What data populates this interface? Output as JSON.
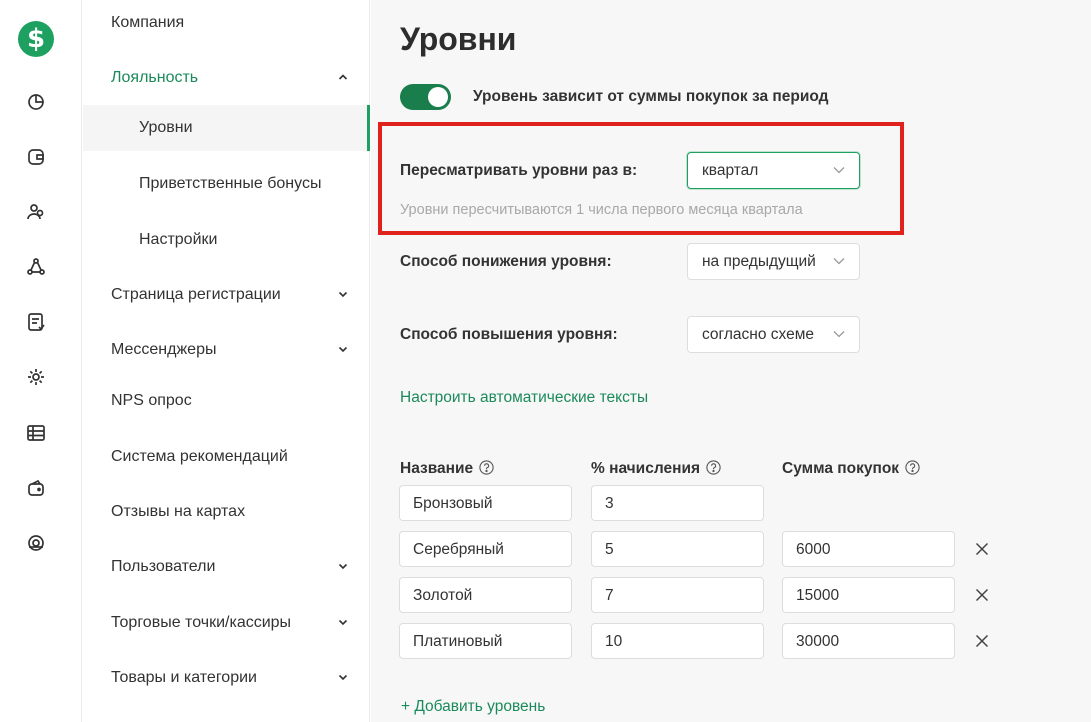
{
  "rail": {
    "logo_symbol": "$",
    "icons": [
      "dashboard-icon",
      "wallet-icon",
      "users-icon",
      "network-icon",
      "document-icon",
      "settings-icon",
      "table-icon",
      "wallet-card-icon",
      "support-icon"
    ],
    "accent": "#1ea060"
  },
  "nav": {
    "items": [
      {
        "label": "Компания"
      },
      {
        "label": "Лояльность"
      },
      {
        "label": "Уровни"
      },
      {
        "label": "Приветственные бонусы"
      },
      {
        "label": "Настройки"
      },
      {
        "label": "Страница регистрации"
      },
      {
        "label": "Мессенджеры"
      },
      {
        "label": "NPS опрос"
      },
      {
        "label": "Система рекомендаций"
      },
      {
        "label": "Отзывы на картах"
      },
      {
        "label": "Пользователи"
      },
      {
        "label": "Торговые точки/кассиры"
      },
      {
        "label": "Товары и категории"
      }
    ]
  },
  "main": {
    "title": "Уровни",
    "toggle": {
      "label": "Уровень зависит от суммы покупок за период",
      "on": true
    },
    "review": {
      "label": "Пересматривать уровни раз в:",
      "value": "квартал",
      "hint": "Уровни пересчитываются 1 числа первого месяца квартала"
    },
    "downgrade": {
      "label": "Способ понижения уровня:",
      "value": "на предыдущий"
    },
    "upgrade": {
      "label": "Способ повышения уровня:",
      "value": "согласно схеме"
    },
    "auto_texts_link": "Настроить автоматические тексты",
    "table": {
      "headers": [
        "Название",
        "% начисления",
        "Сумма покупок"
      ],
      "rows": [
        {
          "name": "Бронзовый",
          "percent": "3",
          "sum": ""
        },
        {
          "name": "Серебряный",
          "percent": "5",
          "sum": "6000"
        },
        {
          "name": "Золотой",
          "percent": "7",
          "sum": "15000"
        },
        {
          "name": "Платиновый",
          "percent": "10",
          "sum": "30000"
        }
      ]
    },
    "add_level": "+ Добавить уровень"
  },
  "colors": {
    "accent": "#1ea060",
    "link": "#1b8a5a",
    "highlight": "#e0221d"
  }
}
